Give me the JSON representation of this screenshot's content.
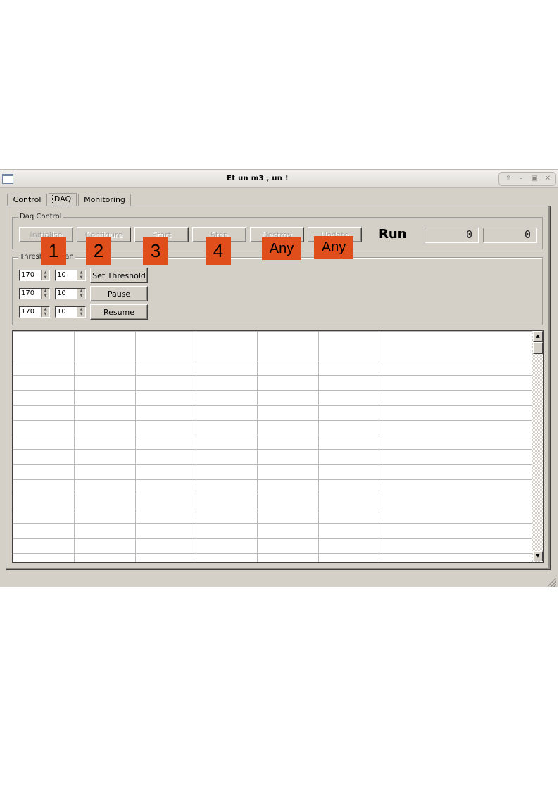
{
  "window": {
    "title": "Et un m3 , un !",
    "controls": [
      "up-arrow-icon",
      "minimize-icon",
      "maximize-icon",
      "close-icon"
    ]
  },
  "tabs": [
    {
      "label": "Control"
    },
    {
      "label": "DAQ"
    },
    {
      "label": "Monitoring"
    }
  ],
  "active_tab": "DAQ",
  "daq_control": {
    "title": "Daq Control",
    "buttons": [
      "Initialise",
      "Configure",
      "Start",
      "Stop",
      "Destroy",
      "Update"
    ],
    "run_label": "Run",
    "counters": [
      "0",
      "0"
    ]
  },
  "threshold_scan": {
    "title": "Threshold Scan",
    "rows": [
      {
        "threshold": "170",
        "step": "10",
        "button": "Set Threshold"
      },
      {
        "threshold": "170",
        "step": "10",
        "button": "Pause"
      },
      {
        "threshold": "170",
        "step": "10",
        "button": "Resume"
      }
    ]
  },
  "markers": [
    "1",
    "2",
    "3",
    "4",
    "Any",
    "Any"
  ],
  "colors": {
    "marker": "#e04e1b",
    "window_bg": "#d4d0c8",
    "disabled_text": "#a8a59f"
  }
}
